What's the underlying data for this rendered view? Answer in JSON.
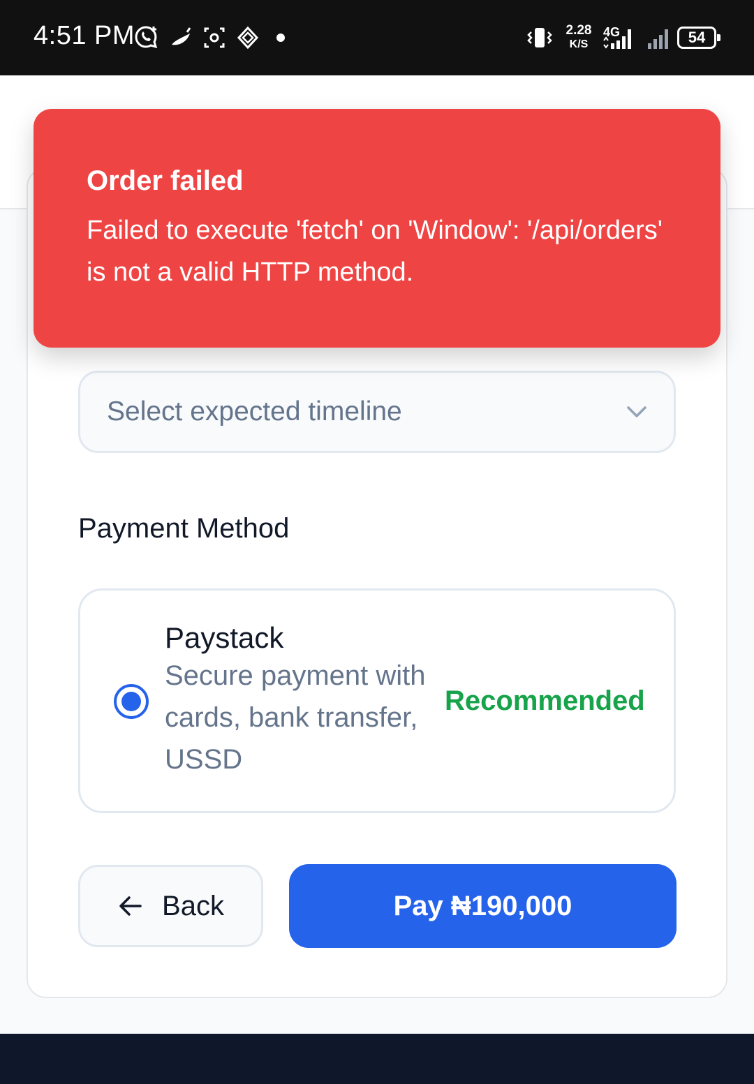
{
  "status_bar": {
    "time": "4:51 PM",
    "speed_value": "2.28",
    "speed_unit": "K/S",
    "network": "4G",
    "battery": "54",
    "icons": [
      "whatsapp-icon",
      "pepper-icon",
      "screenshot-icon",
      "nav-diamond-icon",
      "dot-icon",
      "vibrate-icon",
      "signal-icon",
      "signal-icon-2"
    ]
  },
  "toast": {
    "title": "Order failed",
    "message": "Failed to execute 'fetch' on 'Window': '/api/orders' is not a valid HTTP method."
  },
  "timeline_select": {
    "placeholder": "Select expected timeline",
    "icon": "chevron-down-icon"
  },
  "payment": {
    "section_title": "Payment Method",
    "option": {
      "name": "Paystack",
      "description": "Secure payment with cards, bank transfer, USSD",
      "badge": "Recommended",
      "selected": true
    }
  },
  "actions": {
    "back_label": "Back",
    "back_icon": "arrow-left-icon",
    "pay_label": "Pay ₦190,000"
  },
  "colors": {
    "error": "#ef4444",
    "primary": "#2563eb",
    "success": "#16a34a",
    "muted": "#64748b"
  }
}
